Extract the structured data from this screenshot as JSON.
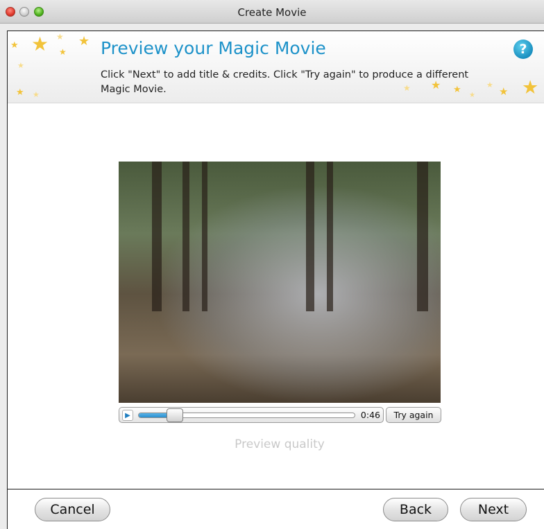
{
  "window": {
    "title": "Create Movie"
  },
  "header": {
    "title": "Preview your Magic Movie",
    "description": "Click \"Next\" to add title & credits. Click \"Try again\" to produce a different Magic Movie.",
    "help_icon": "question-icon",
    "help_glyph": "?",
    "star_glyph": "★"
  },
  "player": {
    "play_icon": "play-icon",
    "play_glyph": "▶",
    "progress": 0.13,
    "time": "0:46",
    "try_again_label": "Try again",
    "quality_label": "Preview quality"
  },
  "footer": {
    "cancel_label": "Cancel",
    "back_label": "Back",
    "next_label": "Next"
  },
  "colors": {
    "accent": "#1d92c9",
    "star": "#f2c33a"
  }
}
